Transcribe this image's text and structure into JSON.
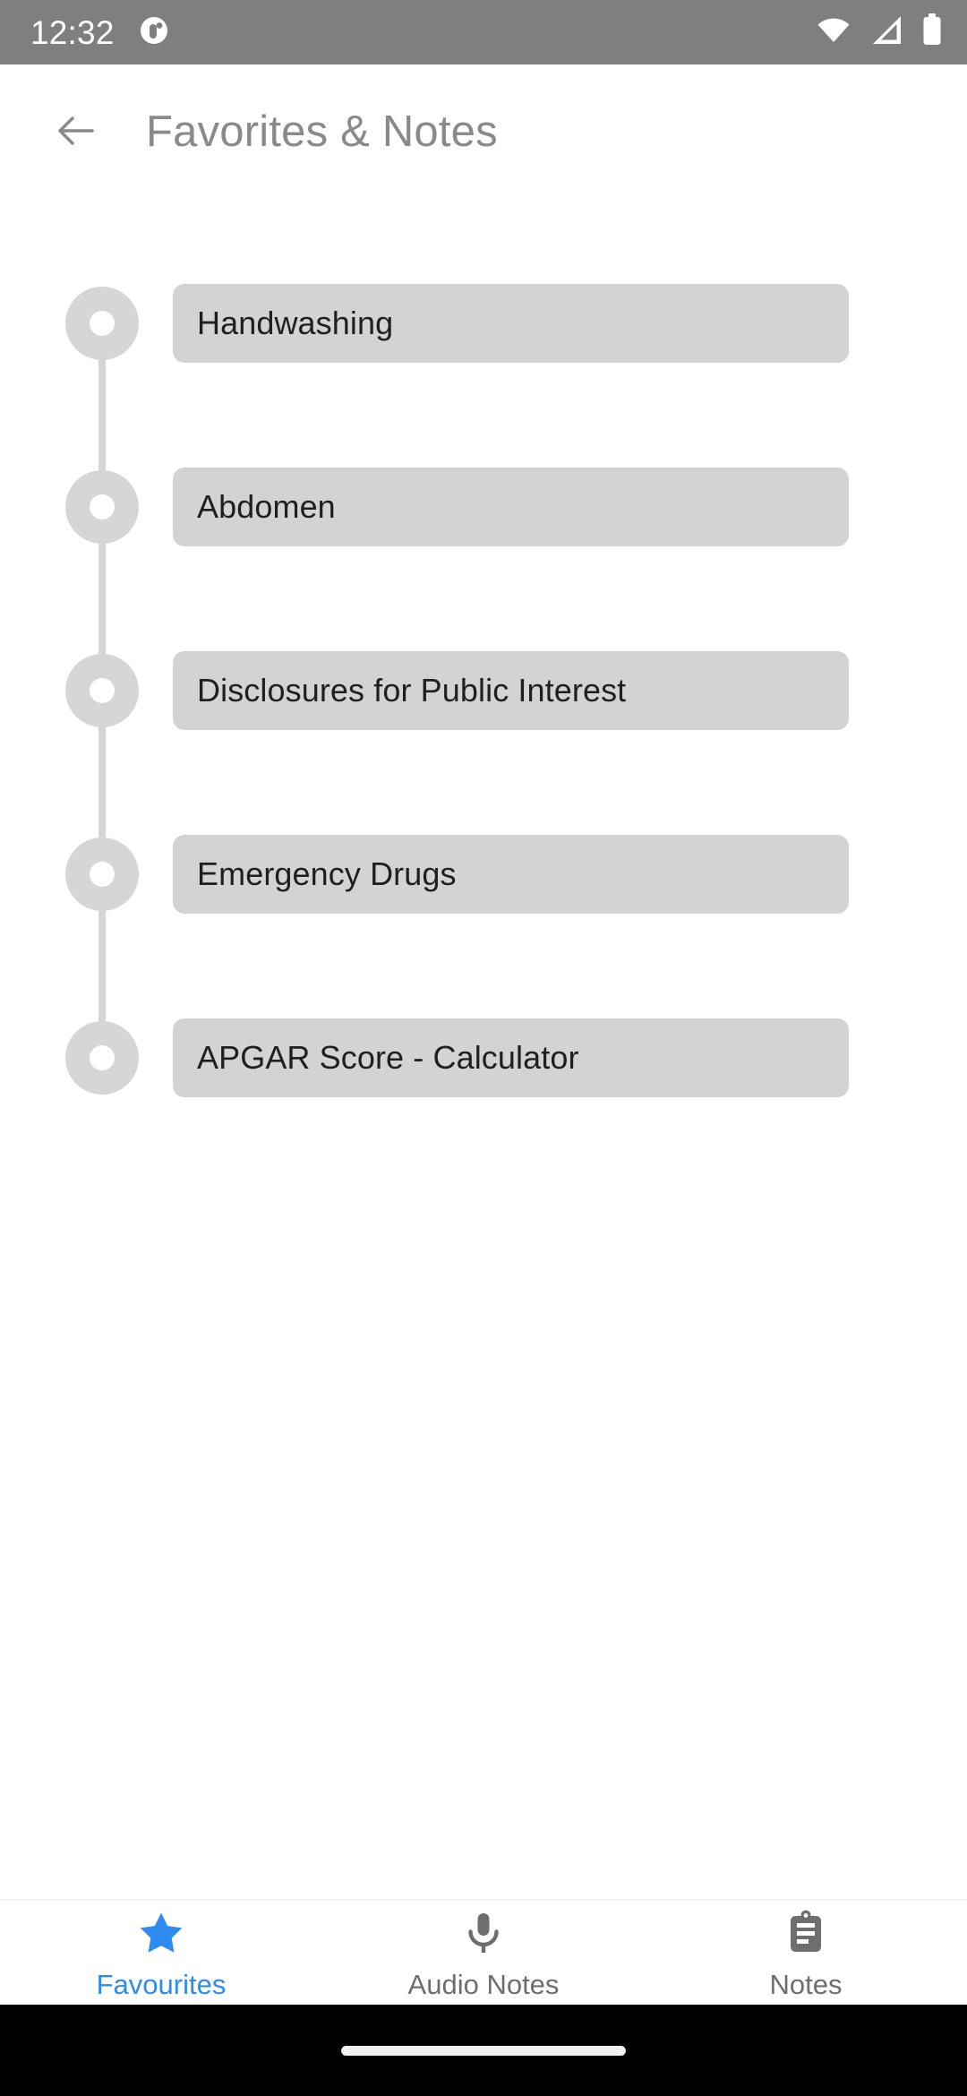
{
  "status_bar": {
    "time": "12:32",
    "notification_icon": "circle-notification-icon",
    "wifi_icon": "wifi-icon",
    "signal_icon": "cellular-signal-icon",
    "battery_icon": "battery-full-icon",
    "background_color": "#7f7f7f"
  },
  "appbar": {
    "back_icon": "arrow-left-icon",
    "title": "Favorites & Notes",
    "title_color": "#8a8a8a"
  },
  "timeline": {
    "dot_color": "#d6d6d6",
    "chip_color": "#d3d3d3",
    "items": [
      {
        "label": "Handwashing"
      },
      {
        "label": "Abdomen"
      },
      {
        "label": "Disclosures for Public Interest"
      },
      {
        "label": "Emergency Drugs"
      },
      {
        "label": "APGAR Score - Calculator"
      }
    ]
  },
  "bottom_nav": {
    "active_color": "#2e8bf0",
    "inactive_color": "#6e6e6e",
    "items": [
      {
        "label": "Favourites",
        "icon": "star-icon",
        "active": true
      },
      {
        "label": "Audio Notes",
        "icon": "microphone-icon",
        "active": false
      },
      {
        "label": "Notes",
        "icon": "clipboard-icon",
        "active": false
      }
    ]
  },
  "gesture_bar": {
    "handle": "home-gesture-pill"
  }
}
